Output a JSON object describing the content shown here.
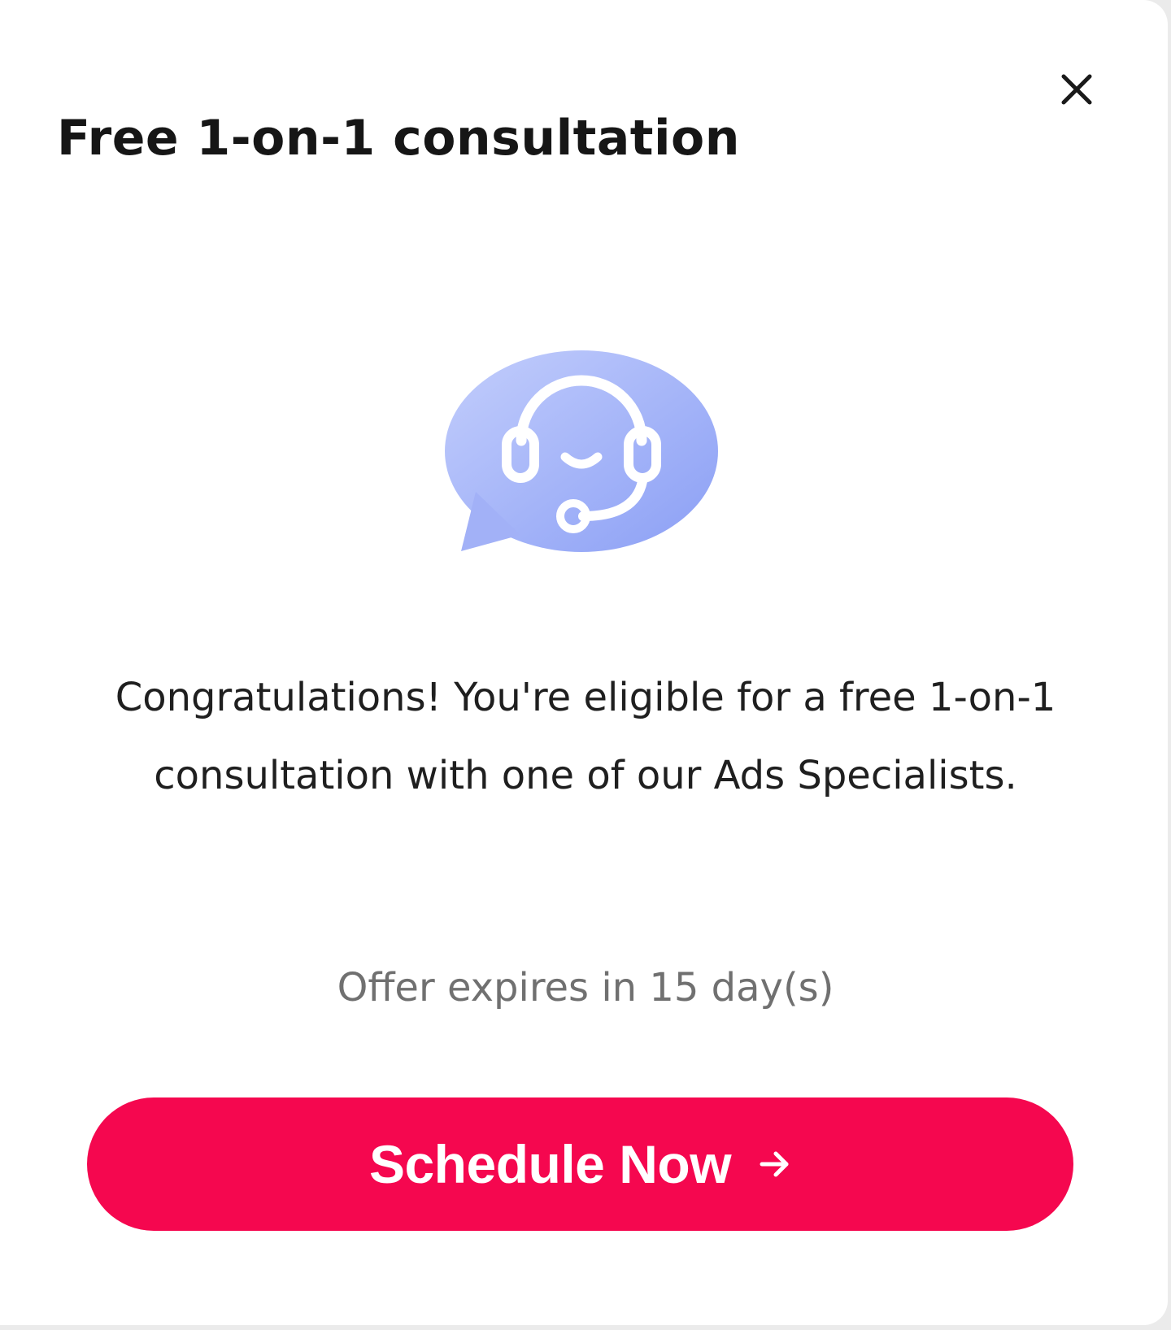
{
  "modal": {
    "title": "Free 1-on-1 consultation",
    "close_icon": "close-icon",
    "hero_icon": "headset-chat-icon",
    "message": "Congratulations! You're eligible for a free 1-on-1 consultation with one of our Ads Specialists.",
    "expiry_text": "Offer expires in 15 day(s)",
    "cta": {
      "label": "Schedule Now",
      "icon": "arrow-right-icon"
    }
  },
  "colors": {
    "accent": "#f5074f",
    "icon_gradient_start": "#b9c6fb",
    "icon_gradient_end": "#8ea2f5",
    "title_text": "#161616",
    "body_text": "#1f1f1f",
    "muted_text": "#707070"
  }
}
